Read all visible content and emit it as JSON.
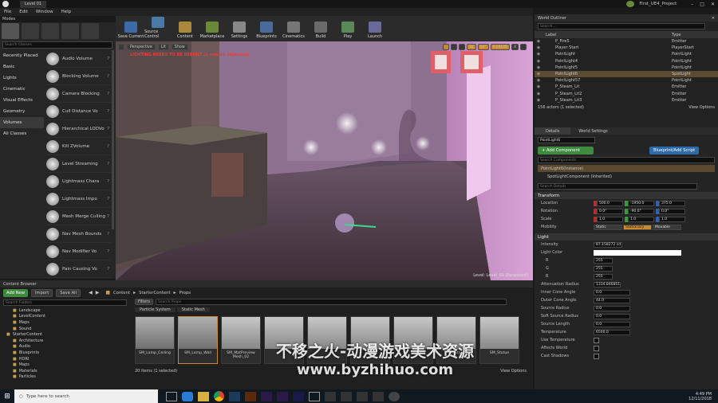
{
  "window": {
    "tab": "Level 01",
    "project": "First_UE4_Project"
  },
  "menu": [
    "File",
    "Edit",
    "Window",
    "Help"
  ],
  "modes": {
    "title": "Modes",
    "search_placeholder": "Search Classes",
    "categories": [
      "Recently Placed",
      "Basic",
      "Lights",
      "Cinematic",
      "Visual Effects",
      "Geometry",
      "Volumes",
      "All Classes"
    ],
    "selected_category": "Volumes",
    "items": [
      "Audio Volume",
      "Blocking Volume",
      "Camera Blocking",
      "Cull Distance Vo",
      "Hierarchical LODVo",
      "Kill ZVolume",
      "Level Streaming",
      "Lightmass Chara",
      "Lightmass Impo",
      "Mesh Merge Culling",
      "Nav Mesh Bounds",
      "Nav Modifier Vo",
      "Pain Causing Vo"
    ]
  },
  "toolbar": [
    "Save Current",
    "Source Control",
    "Content",
    "Marketplace",
    "Settings",
    "Blueprints",
    "Cinematics",
    "Build",
    "Play",
    "Launch"
  ],
  "viewport": {
    "perspective": "Perspective",
    "lit": "Lit",
    "show": "Show",
    "warning": "LIGHTING NEEDS TO BE REBUILT (1 unbuilt object(s))",
    "snap1": "10",
    "snap2": "10°",
    "snap3": "0.03125",
    "camera": "4",
    "level_label": "Level: Level_00 (Persistent)"
  },
  "outliner": {
    "title": "World Outliner",
    "search_placeholder": "Search...",
    "col_label": "Label",
    "col_type": "Type",
    "rows": [
      {
        "label": "P_Fire5",
        "type": "Emitter"
      },
      {
        "label": "Player Start",
        "type": "PlayerStart"
      },
      {
        "label": "PointLight",
        "type": "PointLight"
      },
      {
        "label": "PointLight4",
        "type": "PointLight"
      },
      {
        "label": "PointLight5",
        "type": "PointLight"
      },
      {
        "label": "PointLight6",
        "type": "SpotLight",
        "selected": true
      },
      {
        "label": "PointLight57",
        "type": "PointLight"
      },
      {
        "label": "P_Steam_Lit",
        "type": "Emitter"
      },
      {
        "label": "P_Steam_Lit2",
        "type": "Emitter"
      },
      {
        "label": "P_Steam_Lit3",
        "type": "Emitter"
      }
    ],
    "count": "156 actors (1 selected)",
    "view_options": "View Options"
  },
  "details": {
    "tab1": "Details",
    "tab2": "World Settings",
    "name": "PointLight6",
    "add_component": "+ Add Component",
    "blueprint": "Blueprint/Add Script",
    "search_components": "Search Components",
    "comp1": "PointLight6(Instance)",
    "comp2": "SpotLightComponent (Inherited)",
    "search_details": "Search Details",
    "transform": "Transform",
    "location": {
      "label": "Location",
      "x": "500.0",
      "y": "-1950.0",
      "z": "375.0"
    },
    "rotation": {
      "label": "Rotation",
      "x": "0.0°",
      "y": "-90.0°",
      "z": "0.0°"
    },
    "scale": {
      "label": "Scale",
      "x": "1.0",
      "y": "1.0",
      "z": "1.0"
    },
    "mobility": {
      "label": "Mobility",
      "static": "Static",
      "stationary": "Stationary",
      "movable": "Movable"
    },
    "light": "Light",
    "intensity": {
      "label": "Intensity",
      "value": "87.158272 cd"
    },
    "light_color": "Light Color",
    "r": {
      "label": "R",
      "value": "255"
    },
    "g": {
      "label": "G",
      "value": "255"
    },
    "b": {
      "label": "B",
      "value": "255"
    },
    "attenuation": {
      "label": "Attenuation Radius",
      "value": "1334.846851"
    },
    "inner_cone": {
      "label": "Inner Cone Angle",
      "value": "0.0"
    },
    "outer_cone": {
      "label": "Outer Cone Angle",
      "value": "44.0"
    },
    "source_radius": {
      "label": "Source Radius",
      "value": "0.0"
    },
    "soft_source": {
      "label": "Soft Source Radius",
      "value": "0.0"
    },
    "source_length": {
      "label": "Source Length",
      "value": "0.0"
    },
    "temperature": {
      "label": "Temperature",
      "value": "6500.0"
    },
    "use_temperature": "Use Temperature",
    "affects_world": "Affects World",
    "cast_shadows": "Cast Shadows"
  },
  "content": {
    "title": "Content Browser",
    "add_new": "Add New",
    "import": "Import",
    "save_all": "Save All",
    "breadcrumb": [
      "Content",
      "StarterContent",
      "Props"
    ],
    "search_folders": "Search Folders",
    "filters": "Filters",
    "search_props": "Search Props",
    "folders": [
      "Landscape",
      "LevelContent",
      "Maps",
      "Sound",
      "StarterContent",
      "Architecture",
      "Audio",
      "Blueprints",
      "HDRI",
      "Maps",
      "Materials",
      "Particles"
    ],
    "tabs": [
      "Particle System",
      "Static Mesh"
    ],
    "tiles": [
      "SM_Lamp_Ceiling",
      "SM_Lamp_Wall",
      "SM_MatPreview Mesh_02",
      "",
      "",
      "",
      "",
      "SM_Stairs",
      "SM_Statue"
    ],
    "count": "20 items (1 selected)",
    "view_options": "View Options"
  },
  "watermark": {
    "line1": "不移之火-动漫游戏美术资源",
    "line2": "www.byzhihuo.com"
  },
  "taskbar": {
    "search": "Type here to search",
    "time": "4:49 PM",
    "date": "12/11/2018"
  }
}
